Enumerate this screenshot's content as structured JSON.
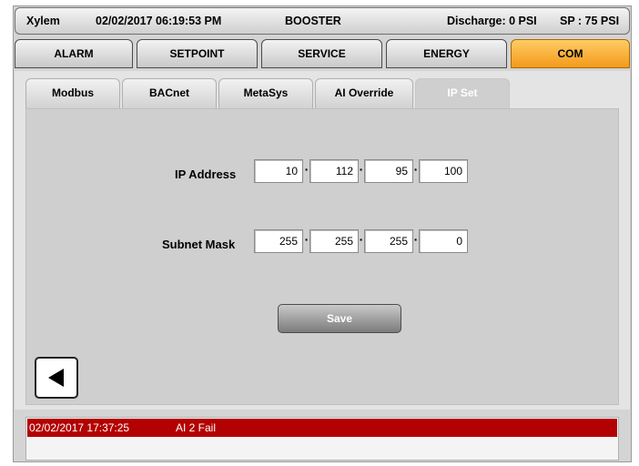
{
  "header": {
    "brand": "Xylem",
    "datetime": "02/02/2017 06:19:53 PM",
    "mode": "BOOSTER",
    "discharge": "Discharge: 0 PSI",
    "setpoint": "SP : 75 PSI"
  },
  "main_tabs": [
    {
      "label": "ALARM"
    },
    {
      "label": "SETPOINT"
    },
    {
      "label": "SERVICE"
    },
    {
      "label": "ENERGY"
    },
    {
      "label": "COM",
      "active": true
    }
  ],
  "sub_tabs": [
    {
      "label": "Modbus"
    },
    {
      "label": "BACnet"
    },
    {
      "label": "MetaSys"
    },
    {
      "label": "AI Override"
    },
    {
      "label": "IP Set",
      "active": true
    }
  ],
  "ip_address": {
    "label": "IP Address",
    "octets": [
      "10",
      "112",
      "95",
      "100"
    ]
  },
  "subnet_mask": {
    "label": "Subnet Mask",
    "octets": [
      "255",
      "255",
      "255",
      "0"
    ]
  },
  "dot_glyph": "·",
  "save_label": "Save",
  "alarm": {
    "timestamp": "02/02/2017 17:37:25",
    "message": "AI 2 Fail"
  },
  "colors": {
    "active_tab": "#f39a1a",
    "alarm_row": "#b30000"
  },
  "icons": {
    "back": "left-triangle-icon"
  }
}
